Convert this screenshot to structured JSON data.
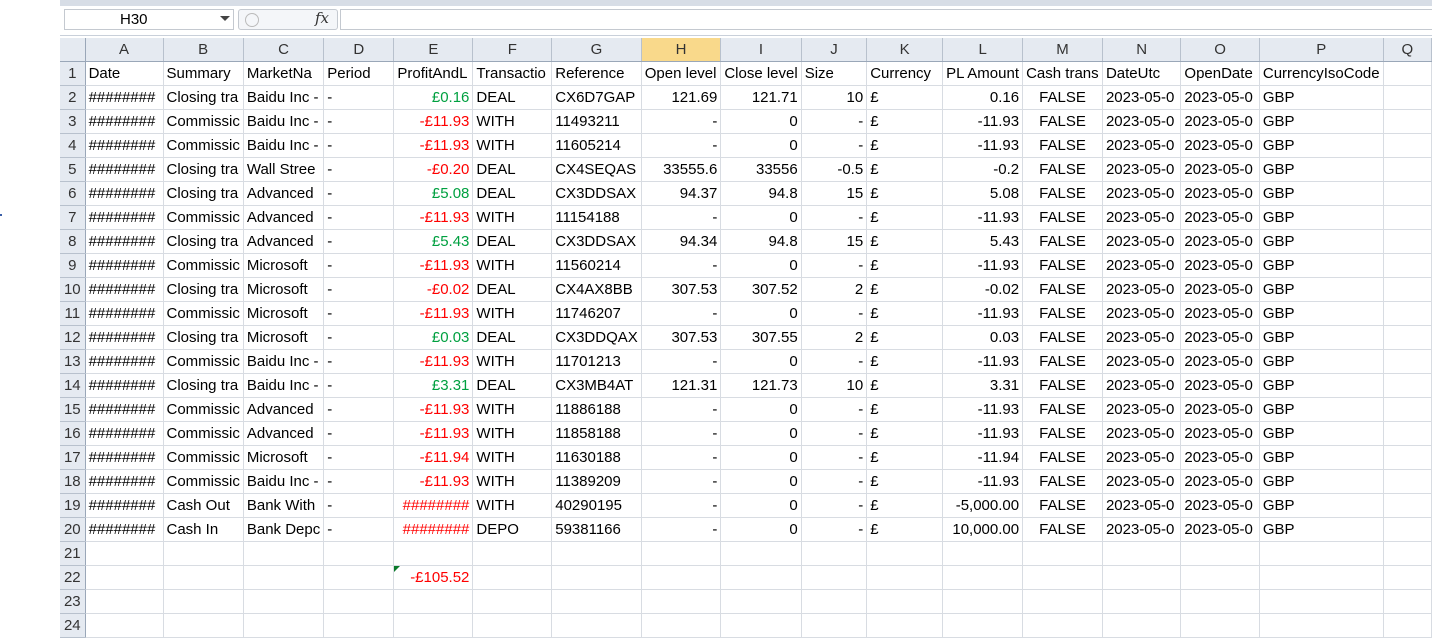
{
  "name_box": "H30",
  "fx_label": "fx",
  "formula_value": "",
  "columns": [
    "A",
    "B",
    "C",
    "D",
    "E",
    "F",
    "G",
    "H",
    "I",
    "J",
    "K",
    "L",
    "M",
    "N",
    "O",
    "P",
    "Q"
  ],
  "selected_column": "H",
  "rows": [
    {
      "n": "1",
      "cells": [
        "Date",
        "Summary",
        "MarketNa",
        "Period",
        "ProfitAndL",
        "Transactio",
        "Reference",
        "Open level",
        "Close level",
        "Size",
        "Currency",
        "PL Amount",
        "Cash trans",
        "DateUtc",
        "OpenDate",
        "CurrencyIsoCode",
        ""
      ]
    },
    {
      "n": "2",
      "cells": [
        "########",
        "Closing tra",
        "Baidu Inc -",
        "-",
        "£0.16",
        "DEAL",
        "CX6D7GAP",
        "121.69",
        "121.71",
        "10",
        "£",
        "0.16",
        "FALSE",
        "2023-05-0",
        "2023-05-0",
        "GBP",
        ""
      ]
    },
    {
      "n": "3",
      "cells": [
        "########",
        "Commissic",
        "Baidu Inc -",
        "-",
        "-£11.93",
        "WITH",
        "11493211",
        "-",
        "0",
        "-",
        "£",
        "-11.93",
        "FALSE",
        "2023-05-0",
        "2023-05-0",
        "GBP",
        ""
      ]
    },
    {
      "n": "4",
      "cells": [
        "########",
        "Commissic",
        "Baidu Inc -",
        "-",
        "-£11.93",
        "WITH",
        "11605214",
        "-",
        "0",
        "-",
        "£",
        "-11.93",
        "FALSE",
        "2023-05-0",
        "2023-05-0",
        "GBP",
        ""
      ]
    },
    {
      "n": "5",
      "cells": [
        "########",
        "Closing tra",
        "Wall Stree",
        "-",
        "-£0.20",
        "DEAL",
        "CX4SEQAS",
        "33555.6",
        "33556",
        "-0.5",
        "£",
        "-0.2",
        "FALSE",
        "2023-05-0",
        "2023-05-0",
        "GBP",
        ""
      ]
    },
    {
      "n": "6",
      "cells": [
        "########",
        "Closing tra",
        "Advanced",
        "-",
        "£5.08",
        "DEAL",
        "CX3DDSAX",
        "94.37",
        "94.8",
        "15",
        "£",
        "5.08",
        "FALSE",
        "2023-05-0",
        "2023-05-0",
        "GBP",
        ""
      ]
    },
    {
      "n": "7",
      "cells": [
        "########",
        "Commissic",
        "Advanced",
        "-",
        "-£11.93",
        "WITH",
        "11154188",
        "-",
        "0",
        "-",
        "£",
        "-11.93",
        "FALSE",
        "2023-05-0",
        "2023-05-0",
        "GBP",
        ""
      ]
    },
    {
      "n": "8",
      "cells": [
        "########",
        "Closing tra",
        "Advanced",
        "-",
        "£5.43",
        "DEAL",
        "CX3DDSAX",
        "94.34",
        "94.8",
        "15",
        "£",
        "5.43",
        "FALSE",
        "2023-05-0",
        "2023-05-0",
        "GBP",
        ""
      ]
    },
    {
      "n": "9",
      "cells": [
        "########",
        "Commissic",
        "Microsoft",
        "-",
        "-£11.93",
        "WITH",
        "11560214",
        "-",
        "0",
        "-",
        "£",
        "-11.93",
        "FALSE",
        "2023-05-0",
        "2023-05-0",
        "GBP",
        ""
      ]
    },
    {
      "n": "10",
      "cells": [
        "########",
        "Closing tra",
        "Microsoft",
        "-",
        "-£0.02",
        "DEAL",
        "CX4AX8BB",
        "307.53",
        "307.52",
        "2",
        "£",
        "-0.02",
        "FALSE",
        "2023-05-0",
        "2023-05-0",
        "GBP",
        ""
      ]
    },
    {
      "n": "11",
      "cells": [
        "########",
        "Commissic",
        "Microsoft",
        "-",
        "-£11.93",
        "WITH",
        "11746207",
        "-",
        "0",
        "-",
        "£",
        "-11.93",
        "FALSE",
        "2023-05-0",
        "2023-05-0",
        "GBP",
        ""
      ]
    },
    {
      "n": "12",
      "cells": [
        "########",
        "Closing tra",
        "Microsoft",
        "-",
        "£0.03",
        "DEAL",
        "CX3DDQAX",
        "307.53",
        "307.55",
        "2",
        "£",
        "0.03",
        "FALSE",
        "2023-05-0",
        "2023-05-0",
        "GBP",
        ""
      ]
    },
    {
      "n": "13",
      "cells": [
        "########",
        "Commissic",
        "Baidu Inc -",
        "-",
        "-£11.93",
        "WITH",
        "11701213",
        "-",
        "0",
        "-",
        "£",
        "-11.93",
        "FALSE",
        "2023-05-0",
        "2023-05-0",
        "GBP",
        ""
      ]
    },
    {
      "n": "14",
      "cells": [
        "########",
        "Closing tra",
        "Baidu Inc -",
        "-",
        "£3.31",
        "DEAL",
        "CX3MB4AT",
        "121.31",
        "121.73",
        "10",
        "£",
        "3.31",
        "FALSE",
        "2023-05-0",
        "2023-05-0",
        "GBP",
        ""
      ]
    },
    {
      "n": "15",
      "cells": [
        "########",
        "Commissic",
        "Advanced",
        "-",
        "-£11.93",
        "WITH",
        "11886188",
        "-",
        "0",
        "-",
        "£",
        "-11.93",
        "FALSE",
        "2023-05-0",
        "2023-05-0",
        "GBP",
        ""
      ]
    },
    {
      "n": "16",
      "cells": [
        "########",
        "Commissic",
        "Advanced",
        "-",
        "-£11.93",
        "WITH",
        "11858188",
        "-",
        "0",
        "-",
        "£",
        "-11.93",
        "FALSE",
        "2023-05-0",
        "2023-05-0",
        "GBP",
        ""
      ]
    },
    {
      "n": "17",
      "cells": [
        "########",
        "Commissic",
        "Microsoft",
        "-",
        "-£11.94",
        "WITH",
        "11630188",
        "-",
        "0",
        "-",
        "£",
        "-11.94",
        "FALSE",
        "2023-05-0",
        "2023-05-0",
        "GBP",
        ""
      ]
    },
    {
      "n": "18",
      "cells": [
        "########",
        "Commissic",
        "Baidu Inc -",
        "-",
        "-£11.93",
        "WITH",
        "11389209",
        "-",
        "0",
        "-",
        "£",
        "-11.93",
        "FALSE",
        "2023-05-0",
        "2023-05-0",
        "GBP",
        ""
      ]
    },
    {
      "n": "19",
      "cells": [
        "########",
        "Cash Out",
        "Bank With",
        "-",
        "########",
        "WITH",
        "40290195",
        "-",
        "0",
        "-",
        "£",
        "-5,000.00",
        "FALSE",
        "2023-05-0",
        "2023-05-0",
        "GBP",
        ""
      ]
    },
    {
      "n": "20",
      "cells": [
        "########",
        "Cash In",
        "Bank Depc",
        "-",
        "########",
        "DEPO",
        "59381166",
        "-",
        "0",
        "-",
        "£",
        "10,000.00",
        "FALSE",
        "2023-05-0",
        "2023-05-0",
        "GBP",
        ""
      ]
    },
    {
      "n": "21",
      "cells": [
        "",
        "",
        "",
        "",
        "",
        "",
        "",
        "",
        "",
        "",
        "",
        "",
        "",
        "",
        "",
        "",
        ""
      ]
    },
    {
      "n": "22",
      "cells": [
        "",
        "",
        "",
        "",
        "-£105.52",
        "",
        "",
        "",
        "",
        "",
        "",
        "",
        "",
        "",
        "",
        "",
        ""
      ]
    },
    {
      "n": "23",
      "cells": [
        "",
        "",
        "",
        "",
        "",
        "",
        "",
        "",
        "",
        "",
        "",
        "",
        "",
        "",
        "",
        "",
        ""
      ]
    },
    {
      "n": "24",
      "cells": [
        "",
        "",
        "",
        "",
        "",
        "",
        "",
        "",
        "",
        "",
        "",
        "",
        "",
        "",
        "",
        "",
        ""
      ]
    }
  ],
  "colors": {
    "positive": "#00a040",
    "negative": "#ff0000",
    "selected_header": "#f9d98b",
    "header_bg": "#e5eaf1"
  }
}
